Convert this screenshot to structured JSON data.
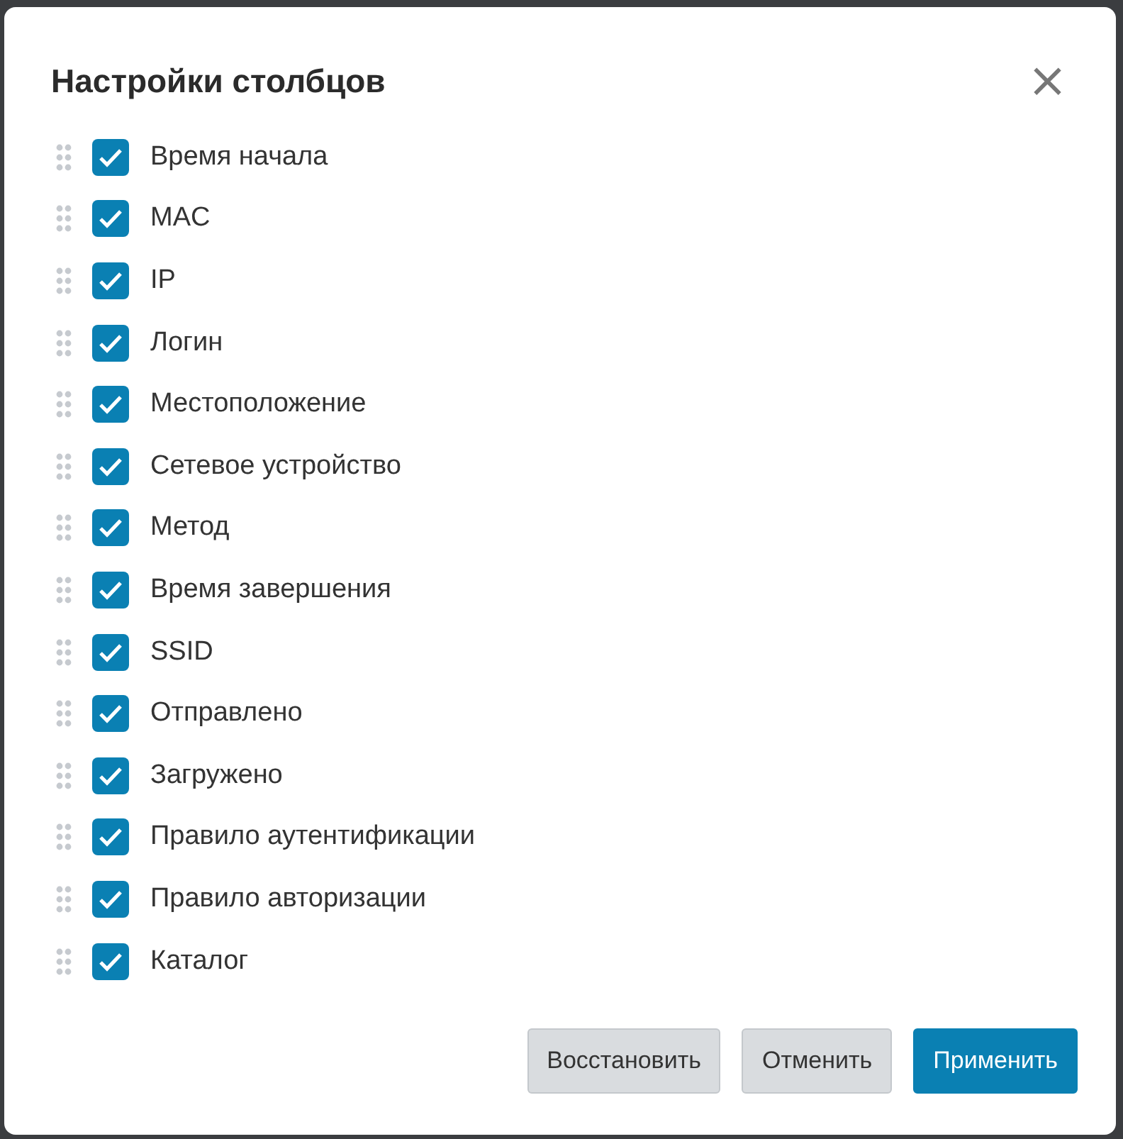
{
  "dialog": {
    "title": "Настройки столбцов",
    "close_glyph": "×"
  },
  "columns": [
    {
      "label": "Время начала",
      "checked": true
    },
    {
      "label": "MAC",
      "checked": true
    },
    {
      "label": "IP",
      "checked": true
    },
    {
      "label": "Логин",
      "checked": true
    },
    {
      "label": "Местоположение",
      "checked": true
    },
    {
      "label": "Сетевое устройство",
      "checked": true
    },
    {
      "label": "Метод",
      "checked": true
    },
    {
      "label": "Время завершения",
      "checked": true
    },
    {
      "label": "SSID",
      "checked": true
    },
    {
      "label": "Отправлено",
      "checked": true
    },
    {
      "label": "Загружено",
      "checked": true
    },
    {
      "label": "Правило аутентификации",
      "checked": true
    },
    {
      "label": "Правило авторизации",
      "checked": true
    },
    {
      "label": "Каталог",
      "checked": true
    }
  ],
  "buttons": [
    {
      "label": "Восстановить",
      "kind": "secondary"
    },
    {
      "label": "Отменить",
      "kind": "secondary"
    },
    {
      "label": "Применить",
      "kind": "primary"
    }
  ]
}
